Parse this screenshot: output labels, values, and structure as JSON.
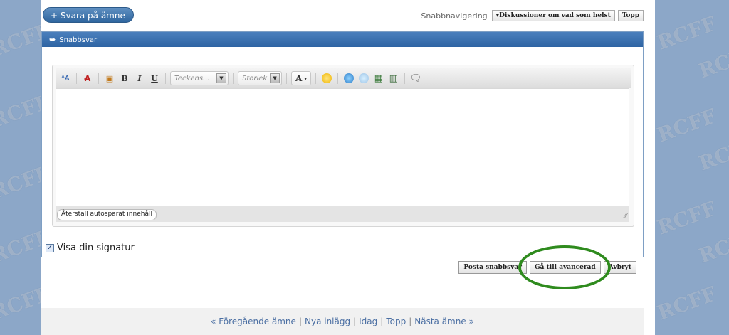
{
  "watermark": "RCFF",
  "header": {
    "reply_button": "+ Svara på ämne",
    "quicknav_label": "Snabbnavigering",
    "quicknav_select": "▾Diskussioner om vad som helst",
    "quicknav_top": "Topp"
  },
  "panel": {
    "title": "Snabbsvar",
    "toolbar": {
      "font_placeholder": "Teckens...",
      "size_placeholder": "Storlek",
      "bold": "B",
      "italic": "I",
      "underline": "U",
      "font_color": "A"
    },
    "restore_button": "Återställ autosparat innehåll",
    "signature_label": "Visa din signatur"
  },
  "actions": {
    "post": "Posta snabbsvar",
    "advanced": "Gå till avancerad",
    "cancel": "Avbryt"
  },
  "footer": {
    "prev": "« Föregående ämne",
    "new_posts": "Nya inlägg",
    "today": "Idag",
    "top": "Topp",
    "next": "Nästa ämne »"
  },
  "colors": {
    "accent": "#2e64a3",
    "highlight": "#2f8b1e"
  }
}
